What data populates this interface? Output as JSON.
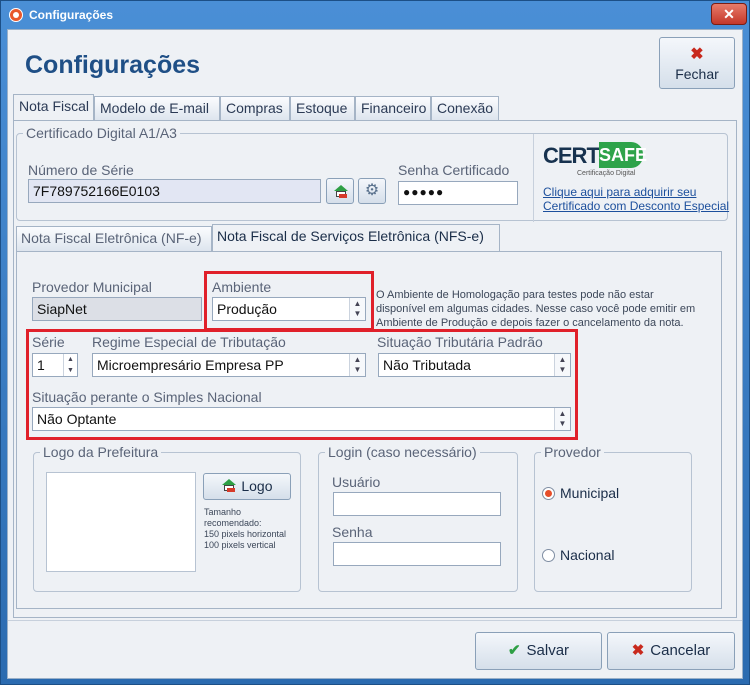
{
  "window": {
    "title": "Configurações",
    "close_glyph": "✕"
  },
  "header": {
    "title": "Configurações",
    "close_button": {
      "glyph": "✖",
      "label": "Fechar"
    }
  },
  "tabs": [
    "Nota Fiscal",
    "Modelo de E-mail",
    "Compras",
    "Estoque",
    "Financeiro",
    "Conexão"
  ],
  "certificado": {
    "group_title": "Certificado Digital A1/A3",
    "serial_label": "Número de Série",
    "serial_value": "7F789752166E0103",
    "password_label": "Senha Certificado",
    "password_value": "●●●●●",
    "brand": {
      "certi": "CERTI",
      "safe": "SAFE",
      "sub": "Certificação Digital"
    },
    "link_text_1": "Clique aqui para adquirir seu",
    "link_text_2": "Certificado com Desconto Especial"
  },
  "subtabs": [
    "Nota Fiscal Eletrônica (NF-e)",
    "Nota Fiscal de Serviços Eletrônica (NFS-e)"
  ],
  "nfse": {
    "provedor_label": "Provedor Municipal",
    "provedor_value": "SiapNet",
    "ambiente_label": "Ambiente",
    "ambiente_value": "Produção",
    "ambiente_note_1": "O Ambiente de Homologação para testes pode não estar",
    "ambiente_note_2": "disponível em algumas cidades. Nesse caso você pode emitir em",
    "ambiente_note_3": "Ambiente de Produção e depois fazer o cancelamento da nota.",
    "serie_label": "Série",
    "serie_value": "1",
    "regime_label": "Regime Especial de Tributação",
    "regime_value": "Microempresário Empresa PP",
    "situacao_trib_label": "Situação Tributária Padrão",
    "situacao_trib_value": "Não Tributada",
    "simples_label": "Situação perante o Simples Nacional",
    "simples_value": "Não Optante",
    "logo_group": "Logo da Prefeitura",
    "logo_button": "Logo",
    "logo_note_1": "Tamanho",
    "logo_note_2": "recomendado:",
    "logo_note_3": "150 pixels horizontal",
    "logo_note_4": "100 pixels vertical",
    "login_group": "Login (caso necessário)",
    "usuario_label": "Usuário",
    "usuario_value": "",
    "senha_label": "Senha",
    "senha_value": "",
    "provedor_group": "Provedor",
    "radio_municipal": "Municipal",
    "radio_nacional": "Nacional",
    "selected_radio": "Municipal"
  },
  "footer": {
    "save_glyph": "✔",
    "save_label": "Salvar",
    "cancel_glyph": "✖",
    "cancel_label": "Cancelar"
  },
  "colors": {
    "accent_red": "#e0202a",
    "title_blue": "#1f4f86",
    "save_green": "#2e9f44",
    "cancel_red": "#c8291d"
  },
  "icons": {
    "certificate_button": "house-certificate-icon",
    "config_button": "gear-icon"
  }
}
